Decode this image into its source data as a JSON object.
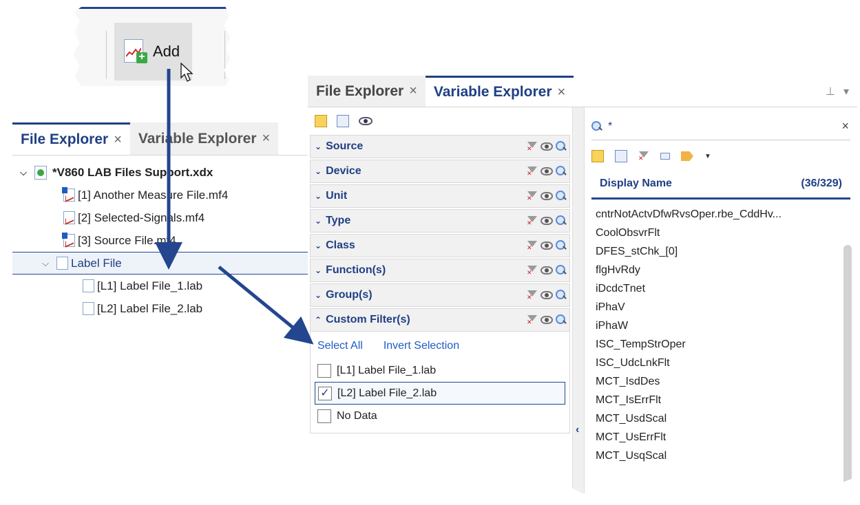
{
  "toolbar": {
    "add_label": "Add"
  },
  "left_explorer": {
    "tabs": [
      {
        "label": "File Explorer",
        "close": "×"
      },
      {
        "label": "Variable Explorer",
        "close": "×"
      }
    ],
    "tree": [
      {
        "label": "*V860 LAB Files Support.xdx",
        "expander": "⌵"
      },
      {
        "label": "[1] Another Measure File.mf4"
      },
      {
        "label": "[2] Selected-Signals.mf4"
      },
      {
        "label": "[3] Source File.mf4"
      },
      {
        "label": "Label File",
        "expander": "⌵"
      },
      {
        "label": "[L1] Label File_1.lab"
      },
      {
        "label": "[L2] Label File_2.lab"
      }
    ]
  },
  "right_explorer": {
    "tabs": [
      {
        "label": "File Explorer",
        "close": "×"
      },
      {
        "label": "Variable Explorer",
        "close": "×"
      }
    ],
    "pin": "⊥",
    "menu": "▾",
    "filters": [
      {
        "label": "Source",
        "chev": "⌄"
      },
      {
        "label": "Device",
        "chev": "⌄"
      },
      {
        "label": "Unit",
        "chev": "⌄"
      },
      {
        "label": "Type",
        "chev": "⌄"
      },
      {
        "label": "Class",
        "chev": "⌄"
      },
      {
        "label": "Function(s)",
        "chev": "⌄"
      },
      {
        "label": "Group(s)",
        "chev": "⌄"
      },
      {
        "label": "Custom Filter(s)",
        "chev": "⌃"
      }
    ],
    "custom": {
      "select_all": "Select All",
      "invert_selection": "Invert Selection",
      "options": [
        {
          "label": "[L1] Label File_1.lab",
          "check": ""
        },
        {
          "label": "[L2] Label File_2.lab",
          "check": "✓"
        },
        {
          "label": "No Data",
          "check": ""
        }
      ]
    },
    "search": {
      "value": "*",
      "clear": "×"
    },
    "list": {
      "header": "Display Name",
      "count": "(36/329)",
      "items": [
        "cntrNotActvDfwRvsOper.rbe_CddHv...",
        "CoolObsvrFlt",
        "DFES_stChk_[0]",
        "flgHvRdy",
        "iDcdcTnet",
        "iPhaV",
        "iPhaW",
        "ISC_TempStrOper",
        "ISC_UdcLnkFlt",
        "MCT_IsdDes",
        "MCT_IsErrFlt",
        "MCT_UsdScal",
        "MCT_UsErrFlt",
        "MCT_UsqScal"
      ]
    },
    "splitter_arrow": "‹"
  },
  "colors": {
    "accent": "#24468f",
    "link": "#1f5bc4",
    "arrow": "#24468f"
  }
}
